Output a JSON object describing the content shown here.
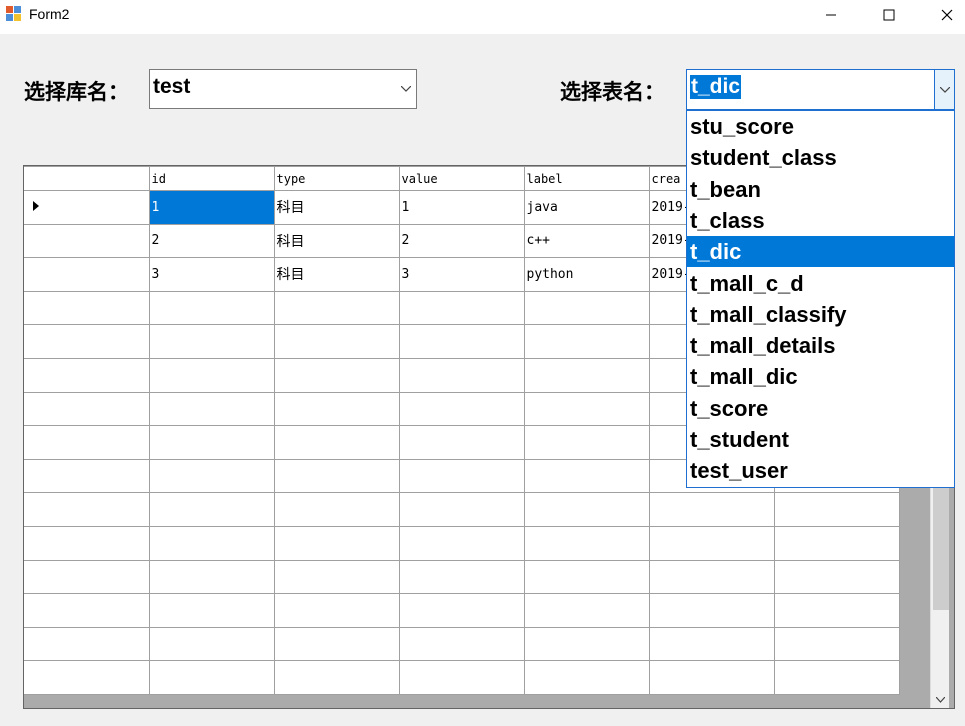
{
  "window": {
    "title": "Form2",
    "controls": {
      "minimize": "—",
      "maximize": "☐",
      "close": "✕"
    }
  },
  "db_selector": {
    "label": "选择库名：",
    "value": "test"
  },
  "table_selector": {
    "label": "选择表名：",
    "value": "t_dic",
    "options": [
      "stu_score",
      "student_class",
      "t_bean",
      "t_class",
      "t_dic",
      "t_mall_c_d",
      "t_mall_classify",
      "t_mall_details",
      "t_mall_dic",
      "t_score",
      "t_student",
      "test_user"
    ],
    "selected_index": 4
  },
  "grid": {
    "columns": [
      "id",
      "type",
      "value",
      "label",
      "crea",
      ""
    ],
    "rows": [
      [
        "1",
        "科目",
        "1",
        "java",
        "2019-",
        ""
      ],
      [
        "2",
        "科目",
        "2",
        "c++",
        "2019-",
        ""
      ],
      [
        "3",
        "科目",
        "3",
        "python",
        "2019-",
        ""
      ]
    ],
    "selected_row": 0,
    "selected_col": 0
  },
  "colors": {
    "selection": "#0078d7",
    "window_bg": "#f0f0f0",
    "grid_bg": "#ababab"
  }
}
